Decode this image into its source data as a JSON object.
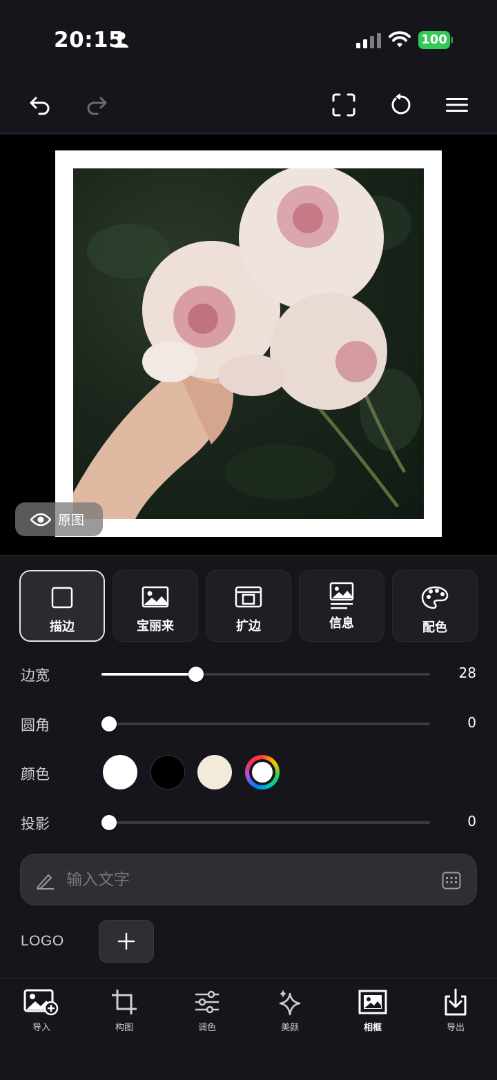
{
  "status_bar": {
    "time": "20:15",
    "battery": "100"
  },
  "toolbar": {
    "icons": [
      "undo-icon",
      "redo-icon",
      "fullscreen-icon",
      "reset-icon",
      "menu-icon"
    ]
  },
  "canvas": {
    "original_label": "原图"
  },
  "frame_tabs": [
    {
      "label": "描边",
      "icon": "square-outline-icon",
      "active": true
    },
    {
      "label": "宝丽来",
      "icon": "image-icon",
      "active": false
    },
    {
      "label": "扩边",
      "icon": "expand-border-icon",
      "active": false
    },
    {
      "label": "信息",
      "icon": "image-info-icon",
      "active": false
    },
    {
      "label": "配色",
      "icon": "palette-icon",
      "active": false
    }
  ],
  "settings": {
    "border_width": {
      "label": "边宽",
      "value": "28",
      "level_fraction": 0.29
    },
    "corner_radius": {
      "label": "圆角",
      "value": "0",
      "level_fraction": 0.0
    },
    "color": {
      "label": "颜色",
      "swatches": [
        "#ffffff",
        "#000000",
        "#f3ebda"
      ],
      "custom_icon": "color-wheel-icon",
      "selected": "#ffffff"
    },
    "shadow": {
      "label": "投影",
      "value": "0",
      "level_fraction": 0.0
    }
  },
  "text_field": {
    "placeholder": "输入文字"
  },
  "logo": {
    "label": "LOGO"
  },
  "bottom_nav": [
    {
      "label": "导入",
      "icon": "import-image-icon"
    },
    {
      "label": "构图",
      "icon": "crop-icon"
    },
    {
      "label": "调色",
      "icon": "adjust-icon"
    },
    {
      "label": "美颜",
      "icon": "sparkle-icon"
    },
    {
      "label": "相框",
      "icon": "frame-icon",
      "active": true
    },
    {
      "label": "导出",
      "icon": "export-icon"
    }
  ]
}
